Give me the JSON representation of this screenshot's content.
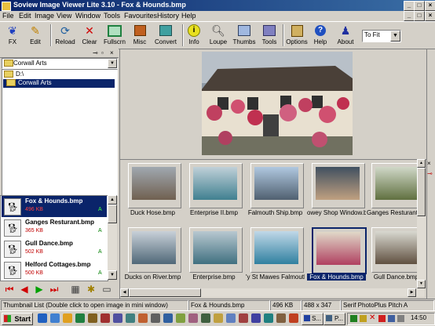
{
  "window": {
    "title": "Soview Image Viewer Lite 3.10 - Fox & Hounds.bmp"
  },
  "menu": [
    "File",
    "Edit",
    "Image",
    "View",
    "Window",
    "Tools",
    "Favourites",
    "History",
    "Help"
  ],
  "toolbar": {
    "fx": "FX",
    "edit": "Edit",
    "reload": "Reload",
    "clear": "Clear",
    "fullscrn": "Fullscrn",
    "misc": "Misc",
    "convert": "Convert",
    "info": "Info",
    "loupe": "Loupe",
    "thumbs": "Thumbs",
    "tools": "Tools",
    "options": "Options",
    "help": "Help",
    "about": "About",
    "zoom": "To Fit"
  },
  "folders": {
    "combo": "Corwall Arts",
    "tree_root": "D:\\",
    "tree_selected": "Corwall Arts"
  },
  "files": [
    {
      "name": "Fox & Hounds.bmp",
      "size": "496 KB",
      "attr": "A",
      "icon": "dog"
    },
    {
      "name": "Ganges Resturant.bmp",
      "size": "365 KB",
      "attr": "A",
      "icon": "dog"
    },
    {
      "name": "Gull Dance.bmp",
      "size": "502 KB",
      "attr": "A",
      "icon": "dog"
    },
    {
      "name": "Helford Cottages.bmp",
      "size": "500 KB",
      "attr": "A",
      "icon": "dog"
    }
  ],
  "thumbnails": [
    {
      "caption": "Duck Hose.bmp"
    },
    {
      "caption": "Enterprise II.bmp"
    },
    {
      "caption": "Falmouth Ship.bmp"
    },
    {
      "caption": "owey Shop Window.bm"
    },
    {
      "caption": "Ganges Resturant.bmp"
    },
    {
      "caption": "Ducks on River.bmp"
    },
    {
      "caption": "Enterprise.bmp"
    },
    {
      "caption": "'y St Mawes Falmouth.t"
    },
    {
      "caption": "Fox & Hounds.bmp",
      "selected": true
    },
    {
      "caption": "Gull Dance.bmp"
    }
  ],
  "status": {
    "hint": "Thumbnail List (Double click to open image in mini window)",
    "file": "Fox & Hounds.bmp",
    "size": "496 KB",
    "dims": "488 x 347",
    "printer": "Serif PhotoPlus Pitch A"
  },
  "taskbar": {
    "start": "Start",
    "task1": "S...",
    "task2": "P...",
    "clock": "14:50"
  }
}
